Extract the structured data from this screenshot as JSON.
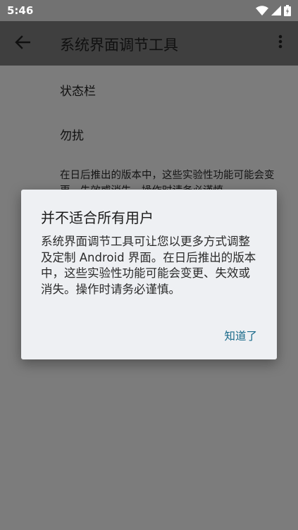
{
  "status_bar": {
    "time": "5:46"
  },
  "app_bar": {
    "title": "系统界面调节工具"
  },
  "settings_list": {
    "items": [
      "状态栏",
      "勿扰"
    ],
    "note": "在日后推出的版本中，这些实验性功能可能会变更、失效或消失。操作时请务必谨慎。"
  },
  "dialog": {
    "title": "并不适合所有用户",
    "message": "系统界面调节工具可让您以更多方式调整及定制 Android 界面。在日后推出的版本中，这些实验性功能可能会变更、失效或消失。操作时请务必谨慎。",
    "confirm_label": "知道了"
  },
  "colors": {
    "dialog_accent": "#1a6a8a",
    "scrim": "#000000"
  }
}
